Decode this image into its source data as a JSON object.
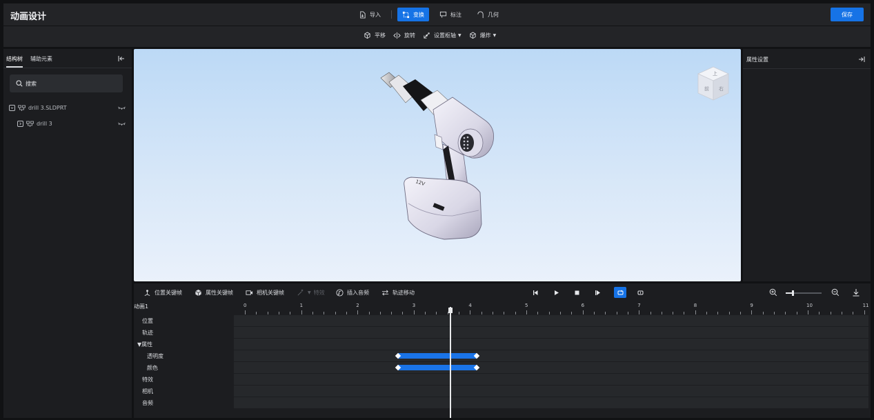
{
  "app": {
    "title": "动画设计"
  },
  "toolbar": {
    "items": [
      {
        "label": "导入",
        "icon": "import-icon"
      },
      {
        "label": "变换",
        "icon": "transform-icon",
        "active": true
      },
      {
        "label": "标注",
        "icon": "annotate-icon"
      },
      {
        "label": "几何",
        "icon": "geometry-icon"
      }
    ],
    "save_label": "保存"
  },
  "subtoolbar": {
    "items": [
      {
        "label": "平移",
        "icon": "translate-icon"
      },
      {
        "label": "旋转",
        "icon": "rotate-icon"
      },
      {
        "label": "设置枢轴",
        "icon": "pivot-icon",
        "dropdown": true
      },
      {
        "label": "爆炸",
        "icon": "explode-icon",
        "dropdown": true
      }
    ]
  },
  "left_panel": {
    "tabs": [
      "结构树",
      "辅助元素"
    ],
    "active_tab": "结构树",
    "search": {
      "placeholder": "搜索",
      "value": ""
    },
    "tree": [
      {
        "label": "drill 3.SLDPRT",
        "expanded": true,
        "level": 0
      },
      {
        "label": "drill 3",
        "expanded": false,
        "level": 1
      }
    ]
  },
  "viewport": {
    "model_markings": [
      "12V"
    ],
    "viewcube_faces": [
      "上",
      "前",
      "右"
    ]
  },
  "right_panel": {
    "title": "属性设置"
  },
  "timeline": {
    "toolbar": [
      {
        "label": "位置关键帧",
        "icon": "position-keyframe-icon"
      },
      {
        "label": "属性关键帧",
        "icon": "property-keyframe-icon"
      },
      {
        "label": "相机关键帧",
        "icon": "camera-keyframe-icon"
      },
      {
        "label": "特效",
        "icon": "effect-icon",
        "disabled": true
      },
      {
        "label": "插入音频",
        "icon": "audio-icon"
      },
      {
        "label": "轨迹移动",
        "icon": "track-move-icon"
      }
    ],
    "animation_name": "动画1",
    "ruler_numbers": [
      "0",
      "1",
      "2",
      "3",
      "4",
      "5",
      "6",
      "7",
      "8",
      "9",
      "10",
      "11"
    ],
    "playhead_time": 3.65,
    "rows": [
      {
        "label": "位置"
      },
      {
        "label": "轨迹"
      },
      {
        "label": "▼属性"
      },
      {
        "label": "透明度",
        "indent": true,
        "key_start": 2.72,
        "key_end": 4.12
      },
      {
        "label": "颜色",
        "indent": true,
        "key_start": 2.72,
        "key_end": 4.12
      },
      {
        "label": "特效"
      },
      {
        "label": "相机"
      },
      {
        "label": "音频"
      }
    ],
    "zoom_level": 0.2
  },
  "colors": {
    "accent": "#1673e6",
    "keyframe_bar": "#1a74e8",
    "panel": "#1c1d20",
    "background": "#111214"
  }
}
